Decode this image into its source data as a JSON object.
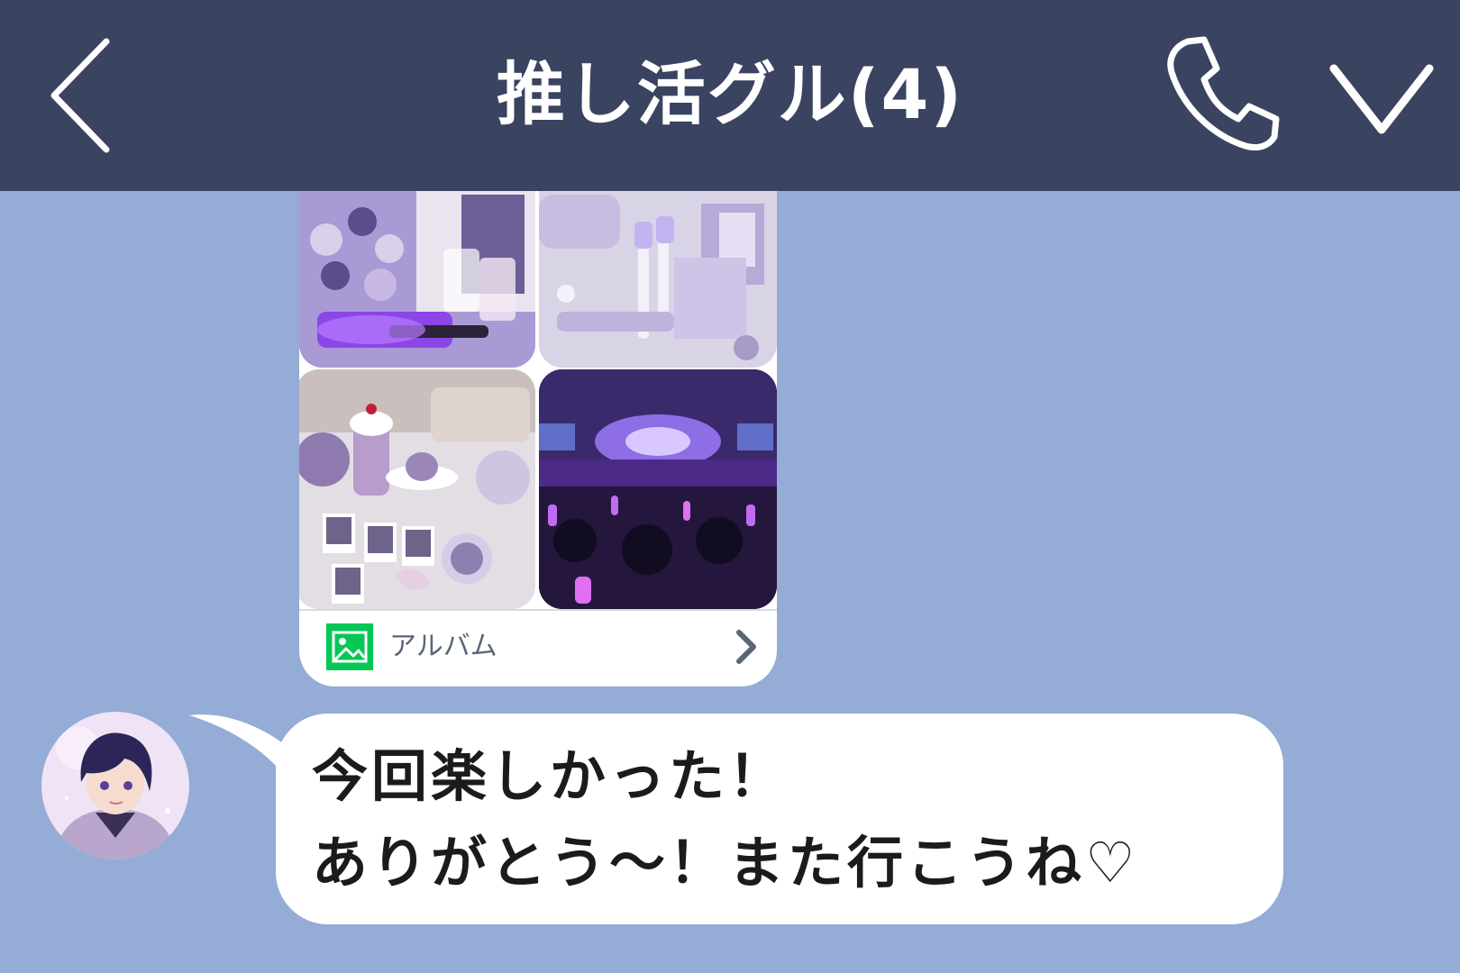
{
  "header": {
    "title": "推し活グル(4)",
    "background": "#3a4461",
    "icons": {
      "back": "chevron-left-icon",
      "call": "phone-icon",
      "menu": "chevron-down-icon"
    }
  },
  "album": {
    "label": "アルバム",
    "icon": "image-icon",
    "icon_color": "#06c755",
    "photos": [
      {
        "name": "merch-photo",
        "palette": "purple"
      },
      {
        "name": "penlight-photo",
        "palette": "lavender"
      },
      {
        "name": "cafe-photo",
        "palette": "lavender"
      },
      {
        "name": "concert-photo",
        "palette": "dark-purple"
      }
    ]
  },
  "message": {
    "sender_avatar": "avatar",
    "lines": [
      "今回楽しかった！",
      "ありがとう～！また行こうね♡"
    ]
  },
  "colors": {
    "chat_background": "#94acd6",
    "bubble": "#ffffff"
  }
}
